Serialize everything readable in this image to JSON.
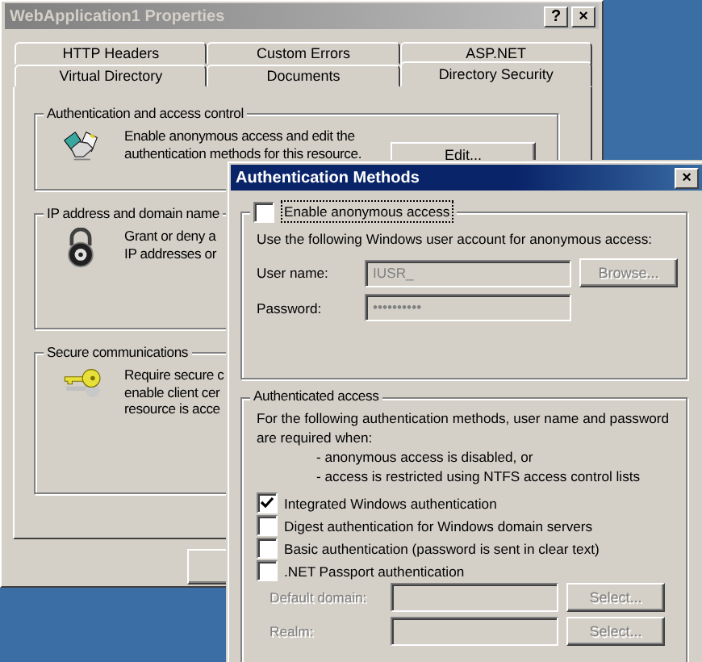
{
  "window": {
    "title": "WebApplication1 Properties",
    "help_button": "?",
    "close_button": "×"
  },
  "tabs": [
    [
      {
        "label": "HTTP Headers",
        "selected": false
      },
      {
        "label": "Custom Errors",
        "selected": false
      },
      {
        "label": "ASP.NET",
        "selected": false
      }
    ],
    [
      {
        "label": "Virtual Directory",
        "selected": false
      },
      {
        "label": "Documents",
        "selected": false
      },
      {
        "label": "Directory Security",
        "selected": true
      }
    ]
  ],
  "groups": [
    {
      "title": "Authentication and access control",
      "kind": "handshake",
      "text": "Enable anonymous access and edit the\nauthentication methods for this resource.",
      "button": "Edit..."
    },
    {
      "title": "IP address and domain name",
      "kind": "padlock",
      "text": "Grant or deny a\nIP addresses or"
    },
    {
      "title": "Secure communications",
      "kind": "key",
      "text": "Require secure c\nenable client cer\nresource is acce"
    }
  ],
  "auth_dialog": {
    "title": "Authentication Methods",
    "close_button": "×",
    "anonymous": {
      "label": "Enable anonymous access",
      "checked": false,
      "note": "Use the following Windows user account for anonymous access:",
      "fields": [
        {
          "label": "User name:",
          "value": "IUSR_",
          "disabled": true
        },
        {
          "label": "Password:",
          "value": "••••••••••",
          "disabled": true
        }
      ],
      "browse_button": {
        "label": "Browse...",
        "disabled": true
      }
    },
    "authenticated": {
      "title": "Authenticated access",
      "text": "For the following authentication methods, user name and password\nare required when:",
      "conditions": [
        "- anonymous access is disabled, or",
        "- access is restricted using NTFS access control lists"
      ],
      "options": [
        {
          "label": "Integrated Windows authentication",
          "checked": true
        },
        {
          "label": "Digest authentication for Windows domain servers",
          "checked": false
        },
        {
          "label": "Basic authentication (password is sent in clear text)",
          "checked": false
        },
        {
          "label": ".NET Passport authentication",
          "checked": false
        }
      ],
      "fields": [
        {
          "label": "Default domain:",
          "disabled": true,
          "button": "Select..."
        },
        {
          "label": "Realm:",
          "disabled": true,
          "button": "Select..."
        }
      ]
    }
  }
}
